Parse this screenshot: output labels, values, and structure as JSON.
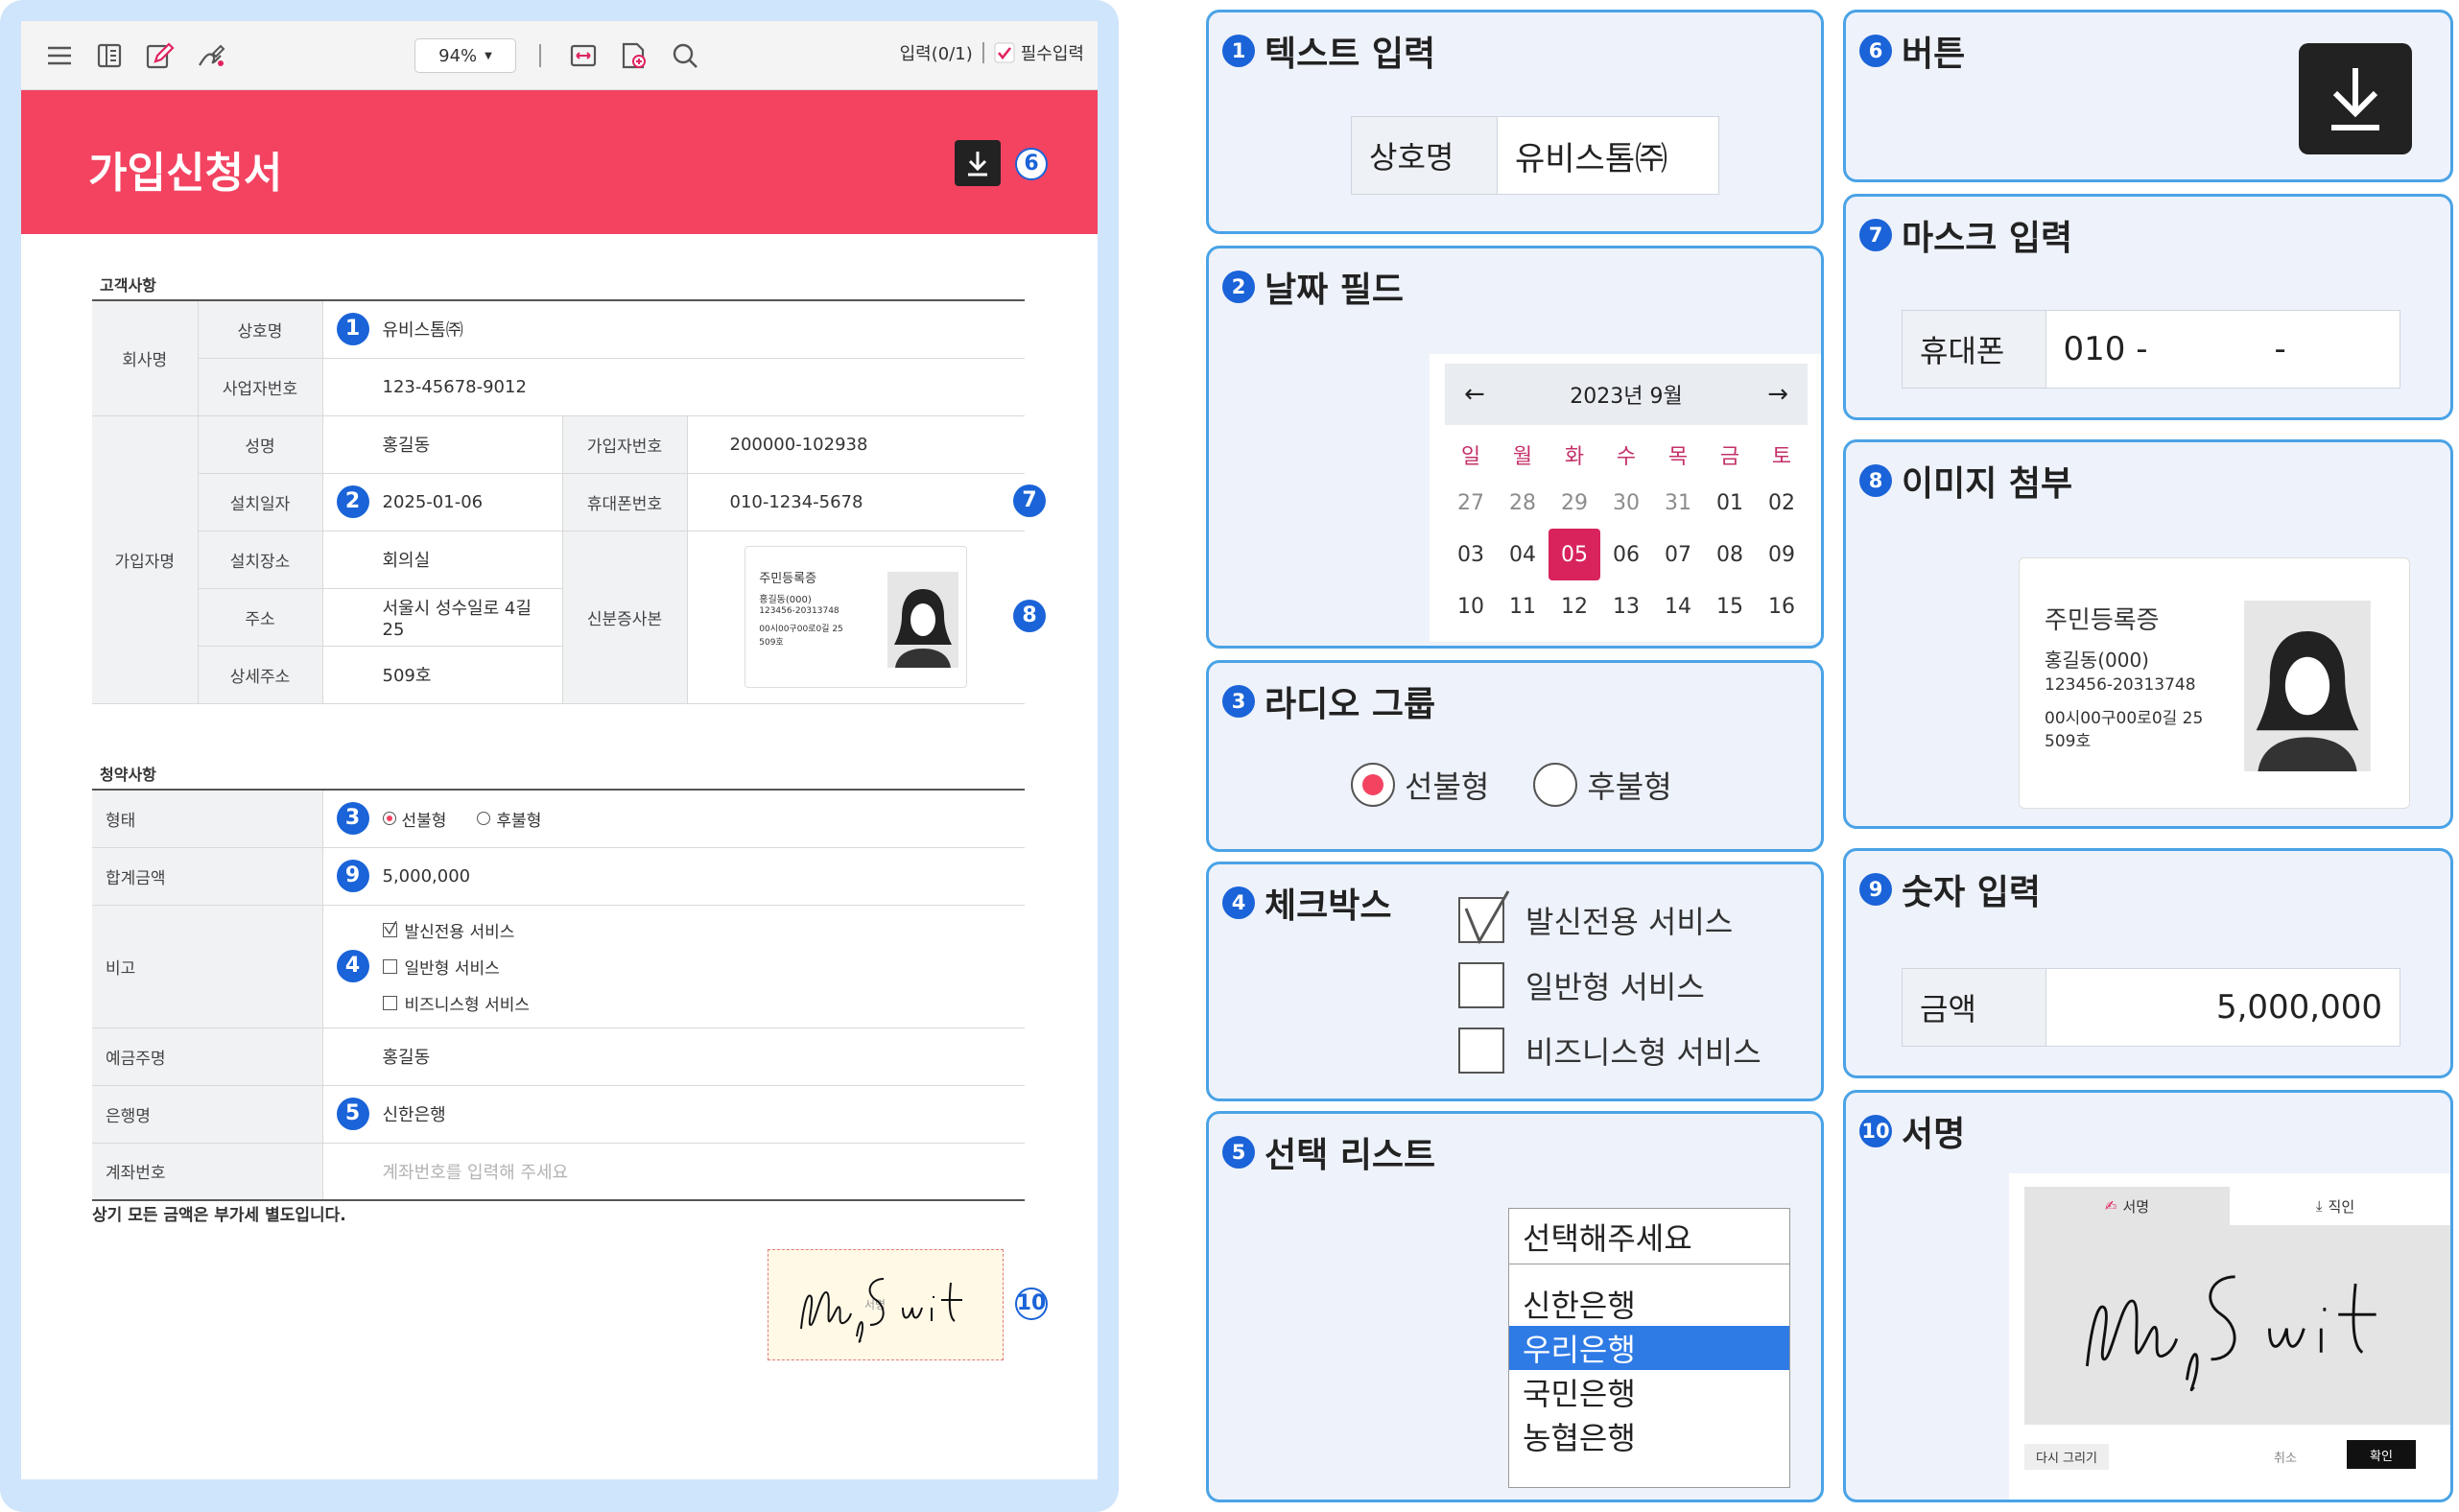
{
  "toolbar": {
    "zoom": "94%",
    "input_status": "입력(0/1)",
    "required_label": "필수입력"
  },
  "doc": {
    "title": "가입신청서",
    "customer_section": "고객사항",
    "company_group": "회사명",
    "biz_name_label": "상호명",
    "biz_name_value": "유비스톰㈜",
    "biz_no_label": "사업자번호",
    "biz_no_value": "123-45678-9012",
    "subscriber_group": "가입자명",
    "name_label": "성명",
    "name_value": "홍길동",
    "sub_no_label": "가입자번호",
    "sub_no_value": "200000-102938",
    "install_date_label": "설치일자",
    "install_date_value": "2025-01-06",
    "phone_label": "휴대폰번호",
    "phone_value": "010-1234-5678",
    "install_place_label": "설치장소",
    "install_place_value": "회의실",
    "id_copy_label": "신분증사본",
    "address_label": "주소",
    "address_value": "서울시 성수일로 4길 25",
    "address_detail_label": "상세주소",
    "address_detail_value": "509호",
    "contract_section": "청약사항",
    "type_label": "형태",
    "type_opt1": "선불형",
    "type_opt2": "후불형",
    "total_label": "합계금액",
    "total_value": "5,000,000",
    "note_label": "비고",
    "note_opt1": "발신전용 서비스",
    "note_opt2": "일반형 서비스",
    "note_opt3": "비즈니스형 서비스",
    "holder_label": "예금주명",
    "holder_value": "홍길동",
    "bank_label": "은행명",
    "bank_value": "신한은행",
    "account_label": "계좌번호",
    "account_placeholder": "계좌번호를 입력해 주세요",
    "vat_note": "상기 모든 금액은 부가세 별도입니다.",
    "sign_caption": "서명"
  },
  "idcard": {
    "title": "주민등록증",
    "name": "홍길동(000)",
    "number": "123456-20313748",
    "address1": "00시00구00로0길 25",
    "address2": "509호"
  },
  "badges": [
    "1",
    "2",
    "3",
    "4",
    "5",
    "6",
    "7",
    "8",
    "9",
    "10"
  ],
  "panels": {
    "p1": {
      "title": "텍스트 입력",
      "label": "상호명",
      "value": "유비스톰㈜"
    },
    "p2": {
      "title": "날짜 필드",
      "month": "2023년 9월",
      "weekdays": [
        "일",
        "월",
        "화",
        "수",
        "목",
        "금",
        "토"
      ],
      "days": [
        {
          "d": "27",
          "m": true
        },
        {
          "d": "28",
          "m": true
        },
        {
          "d": "29",
          "m": true
        },
        {
          "d": "30",
          "m": true
        },
        {
          "d": "31",
          "m": true
        },
        {
          "d": "01"
        },
        {
          "d": "02"
        },
        {
          "d": "03"
        },
        {
          "d": "04"
        },
        {
          "d": "05",
          "s": true
        },
        {
          "d": "06"
        },
        {
          "d": "07"
        },
        {
          "d": "08"
        },
        {
          "d": "09"
        },
        {
          "d": "10"
        },
        {
          "d": "11"
        },
        {
          "d": "12"
        },
        {
          "d": "13"
        },
        {
          "d": "14"
        },
        {
          "d": "15"
        },
        {
          "d": "16"
        }
      ]
    },
    "p3": {
      "title": "라디오 그룹",
      "opt1": "선불형",
      "opt2": "후불형"
    },
    "p4": {
      "title": "체크박스",
      "opt1": "발신전용 서비스",
      "opt2": "일반형 서비스",
      "opt3": "비즈니스형 서비스"
    },
    "p5": {
      "title": "선택 리스트",
      "current": "선택해주세요",
      "options": [
        "신한은행",
        "우리은행",
        "국민은행",
        "농협은행"
      ],
      "highlighted": 1
    },
    "p6": {
      "title": "버튼"
    },
    "p7": {
      "title": "마스크 입력",
      "label": "휴대폰",
      "value": "010 -",
      "dash": "-"
    },
    "p8": {
      "title": "이미지 첨부"
    },
    "p9": {
      "title": "숫자 입력",
      "label": "금액",
      "value": "5,000,000"
    },
    "p10": {
      "title": "서명",
      "tab_sign": "서명",
      "tab_stamp": "직인",
      "redraw": "다시 그리기",
      "cancel": "취소",
      "confirm": "확인"
    }
  },
  "colors": {
    "brand": "#f34361",
    "badge": "#1a63d8",
    "frame": "#cfe5fb",
    "panel_border": "#4aa3e6",
    "select_highlight": "#2f7be6",
    "calendar_selected": "#d8235d"
  }
}
